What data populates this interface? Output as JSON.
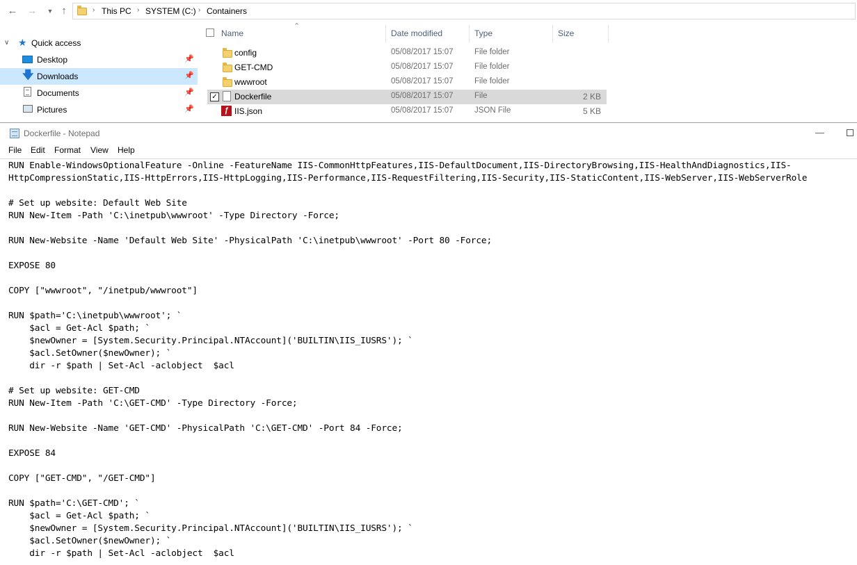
{
  "explorer": {
    "breadcrumb": [
      "This PC",
      "SYSTEM (C:)",
      "Containers"
    ],
    "nav_pane": {
      "quick_access_label": "Quick access",
      "items": [
        {
          "label": "Desktop",
          "icon": "desktop-icon",
          "pinned": true,
          "selected": false
        },
        {
          "label": "Downloads",
          "icon": "download-arrow-icon",
          "pinned": true,
          "selected": true
        },
        {
          "label": "Documents",
          "icon": "documents-icon",
          "pinned": true,
          "selected": false
        },
        {
          "label": "Pictures",
          "icon": "pictures-icon",
          "pinned": true,
          "selected": false
        }
      ]
    },
    "columns": [
      "Name",
      "Date modified",
      "Type",
      "Size"
    ],
    "files": [
      {
        "name": "config",
        "date": "05/08/2017 15:07",
        "type": "File folder",
        "size": "",
        "icon": "folder-icon",
        "selected": false
      },
      {
        "name": "GET-CMD",
        "date": "05/08/2017 15:07",
        "type": "File folder",
        "size": "",
        "icon": "folder-icon",
        "selected": false
      },
      {
        "name": "wwwroot",
        "date": "05/08/2017 15:07",
        "type": "File folder",
        "size": "",
        "icon": "folder-icon",
        "selected": false
      },
      {
        "name": "Dockerfile",
        "date": "05/08/2017 15:07",
        "type": "File",
        "size": "2 KB",
        "icon": "file-icon",
        "selected": true
      },
      {
        "name": "IIS.json",
        "date": "05/08/2017 15:07",
        "type": "JSON File",
        "size": "5 KB",
        "icon": "json-file-icon",
        "selected": false
      }
    ]
  },
  "notepad": {
    "title": "Dockerfile - Notepad",
    "menu": [
      "File",
      "Edit",
      "Format",
      "View",
      "Help"
    ],
    "lines": [
      "RUN Enable-WindowsOptionalFeature -Online -FeatureName IIS-CommonHttpFeatures,IIS-DefaultDocument,IIS-DirectoryBrowsing,IIS-HealthAndDiagnostics,IIS-",
      "HttpCompressionStatic,IIS-HttpErrors,IIS-HttpLogging,IIS-Performance,IIS-RequestFiltering,IIS-Security,IIS-StaticContent,IIS-WebServer,IIS-WebServerRole",
      "",
      "# Set up website: Default Web Site",
      "RUN New-Item -Path 'C:\\inetpub\\wwwroot' -Type Directory -Force;",
      "",
      "RUN New-Website -Name 'Default Web Site' -PhysicalPath 'C:\\inetpub\\wwwroot' -Port 80 -Force;",
      "",
      "EXPOSE 80",
      "",
      "COPY [\"wwwroot\", \"/inetpub/wwwroot\"]",
      "",
      "RUN $path='C:\\inetpub\\wwwroot'; `",
      "    $acl = Get-Acl $path; `",
      "    $newOwner = [System.Security.Principal.NTAccount]('BUILTIN\\IIS_IUSRS'); `",
      "    $acl.SetOwner($newOwner); `",
      "    dir -r $path | Set-Acl -aclobject  $acl",
      "",
      "# Set up website: GET-CMD",
      "RUN New-Item -Path 'C:\\GET-CMD' -Type Directory -Force;",
      "",
      "RUN New-Website -Name 'GET-CMD' -PhysicalPath 'C:\\GET-CMD' -Port 84 -Force;",
      "",
      "EXPOSE 84",
      "",
      "COPY [\"GET-CMD\", \"/GET-CMD\"]",
      "",
      "RUN $path='C:\\GET-CMD'; `",
      "    $acl = Get-Acl $path; `",
      "    $newOwner = [System.Security.Principal.NTAccount]('BUILTIN\\IIS_IUSRS'); `",
      "    $acl.SetOwner($newOwner); `",
      "    dir -r $path | Set-Acl -aclobject  $acl"
    ]
  }
}
